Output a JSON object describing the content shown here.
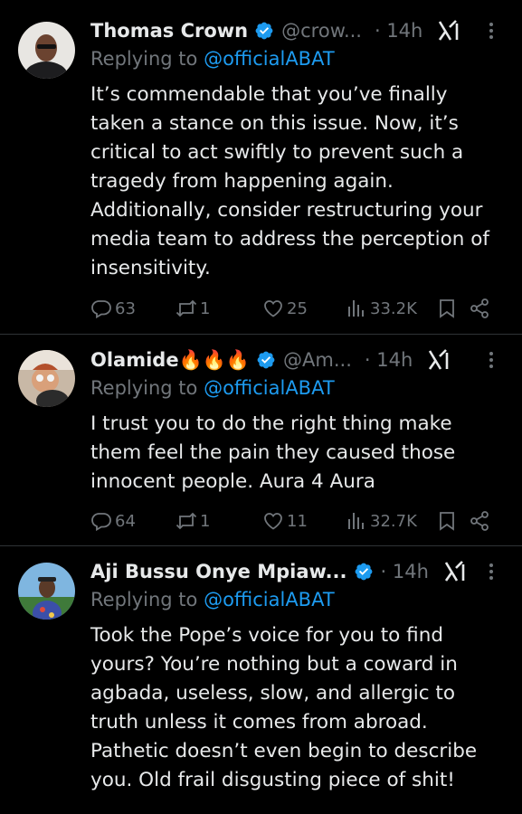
{
  "tweets": [
    {
      "name": "Thomas Crown",
      "handle": "@crow...",
      "time": "· 14h",
      "replying_prefix": "Replying to ",
      "replying_to": "@officialABAT",
      "text": "It’s commendable that you’ve finally taken a stance on this issue. Now, it’s critical to act swiftly to prevent such a tragedy from happening again. Additionally, consider restructuring your media team to address the perception of insensitivity.",
      "replies": "63",
      "reposts": "1",
      "likes": "25",
      "views": "33.2K"
    },
    {
      "name": "Olamide🔥🔥🔥",
      "handle": "@Am...",
      "time": "· 14h",
      "replying_prefix": "Replying to ",
      "replying_to": "@officialABAT",
      "text": "I trust you to do the right thing make them feel the pain they caused those innocent people. Aura 4 Aura",
      "replies": "64",
      "reposts": "1",
      "likes": "11",
      "views": "32.7K"
    },
    {
      "name": "Aji Bussu Onye Mpiaw...",
      "handle": "",
      "time": "· 14h",
      "replying_prefix": "Replying to ",
      "replying_to": "@officialABAT",
      "text": "Took the Pope’s voice for you to find yours? You’re nothing but a coward in agbada, useless, slow, and allergic to truth unless it comes from abroad. Pathetic doesn’t even begin to describe you. Old frail disgusting piece of shit!"
    }
  ],
  "icons": {
    "verified": "verified-badge-icon",
    "grok": "grok-icon",
    "more": "more-options-icon",
    "reply": "reply-icon",
    "repost": "repost-icon",
    "like": "like-icon",
    "views": "views-icon",
    "bookmark": "bookmark-icon",
    "share": "share-icon"
  },
  "colors": {
    "background": "#000000",
    "text": "#e7e9ea",
    "muted": "#71767b",
    "link": "#1d9bf0",
    "divider": "#2f3336"
  }
}
